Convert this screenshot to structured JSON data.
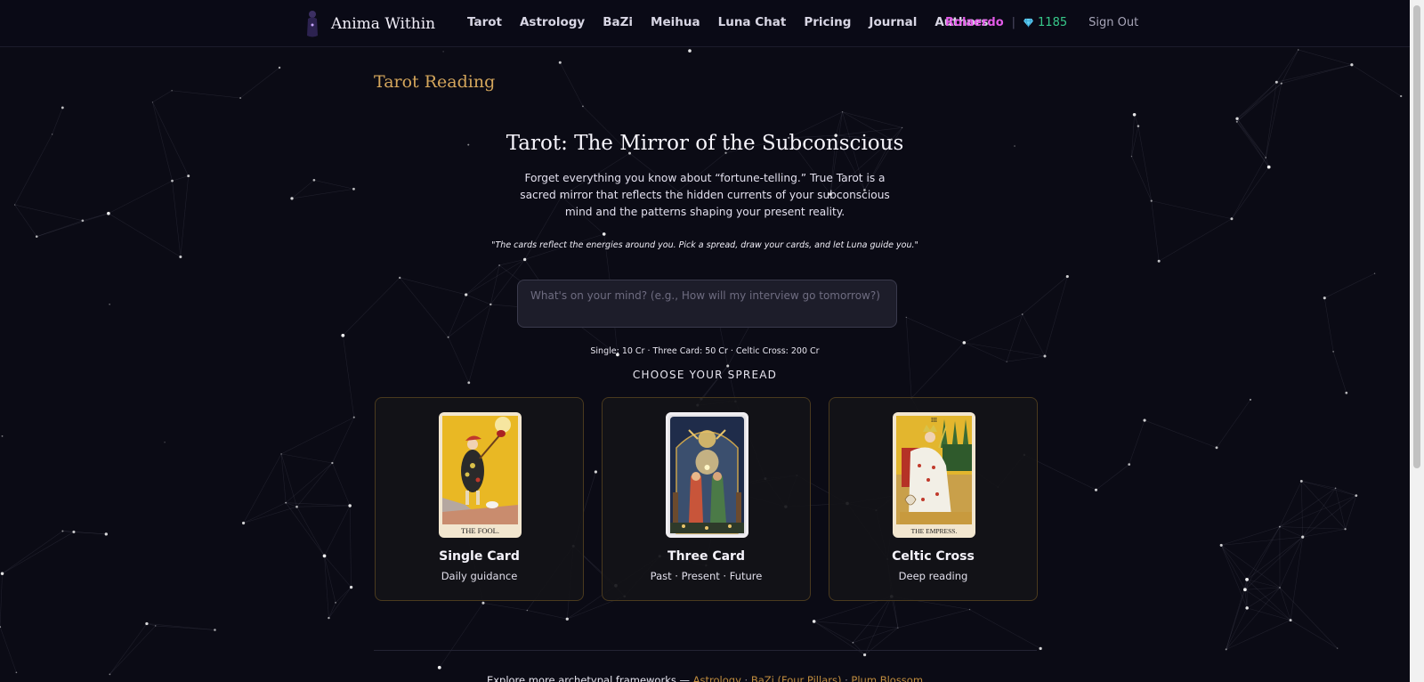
{
  "brand": {
    "name": "Anima Within",
    "logo_icon": "figure-logo-icon"
  },
  "nav": {
    "items": [
      {
        "label": "Tarot"
      },
      {
        "label": "Astrology"
      },
      {
        "label": "BaZi"
      },
      {
        "label": "Meihua"
      },
      {
        "label": "Luna Chat"
      },
      {
        "label": "Pricing"
      },
      {
        "label": "Journal"
      },
      {
        "label": "Authors"
      }
    ]
  },
  "user": {
    "username": "Rolaerdo",
    "separator": "|",
    "credits_icon": "gem-icon",
    "credits": "1185",
    "sign_out": "Sign Out"
  },
  "page": {
    "title": "Tarot Reading",
    "hero_title": "Tarot: The Mirror of the Subconscious",
    "intro": "Forget everything you know about “fortune-telling.” True Tarot is a sacred mirror that reflects the hidden currents of your subconscious mind and the patterns shaping your present reality.",
    "quote": "\"The cards reflect the energies around you. Pick a spread, draw your cards, and let Luna guide you.\"",
    "question_placeholder": "What's on your mind? (e.g., How will my interview go tomorrow?)",
    "question_value": "",
    "pricing": "Single: 10 Cr · Three Card: 50 Cr · Celtic Cross: 200 Cr",
    "choose_label": "CHOOSE YOUR SPREAD"
  },
  "spreads": [
    {
      "name": "Single Card",
      "description": "Daily guidance",
      "card_caption": "THE FOOL.",
      "card_image": "the-fool-card"
    },
    {
      "name": "Three Card",
      "description": "Past · Present · Future",
      "card_caption": "",
      "card_image": "lovers-card"
    },
    {
      "name": "Celtic Cross",
      "description": "Deep reading",
      "card_caption": "THE EMPRESS.",
      "card_numeral": "III",
      "card_image": "the-empress-card"
    }
  ],
  "footer": {
    "prefix": "Explore more archetypal frameworks —",
    "links": [
      "Astrology",
      "BaZi (Four Pillars)",
      "Plum Blossom"
    ],
    "link_separator": "·"
  },
  "colors": {
    "background": "#0b0b15",
    "accent_gold": "#d4a65c",
    "username": "#e35be8",
    "credits": "#37c98a",
    "card_border": "#4a3a1e"
  }
}
